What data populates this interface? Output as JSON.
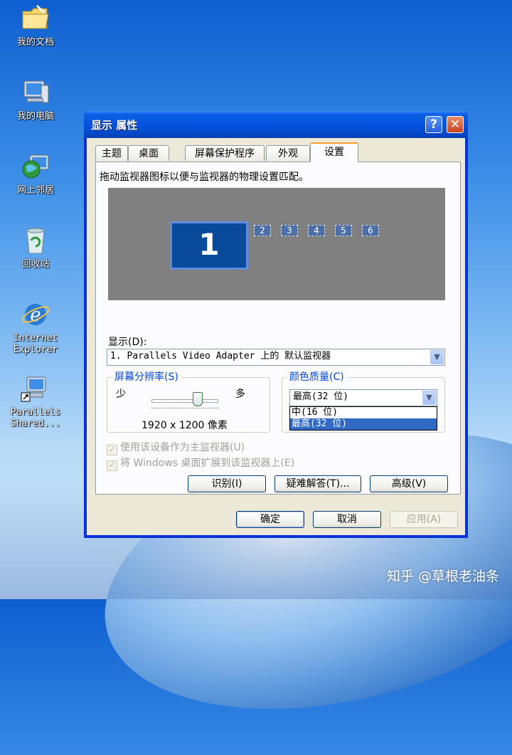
{
  "desktop": {
    "icons": [
      {
        "label": "我的文档",
        "icon": "folder-icon"
      },
      {
        "label": "我的电脑",
        "icon": "computer-icon"
      },
      {
        "label": "网上邻居",
        "icon": "network-icon"
      },
      {
        "label": "回收站",
        "icon": "recycle-bin-icon"
      },
      {
        "label1": "Internet",
        "label2": "Explorer",
        "icon": "ie-icon"
      },
      {
        "label1": "Parallels",
        "label2": "Shared...",
        "icon": "shortcut-icon"
      }
    ],
    "watermark": "知乎 @草根老油条"
  },
  "dialog": {
    "title": "显示 属性",
    "help": "?",
    "close": "✕",
    "tabs": [
      "主题",
      "桌面",
      "屏幕保护程序",
      "外观",
      "设置"
    ],
    "active_tab": "设置",
    "instruction": "拖动监视器图标以便与监视器的物理设置匹配。",
    "monitors": [
      "1",
      "2",
      "3",
      "4",
      "5",
      "6"
    ],
    "display_label": "显示(D):",
    "display_value": "1. Parallels Video Adapter 上的 默认监视器",
    "resolution": {
      "title": "屏幕分辨率(S)",
      "less": "少",
      "more": "多",
      "value": "1920 x 1200 像素",
      "slider_fraction": 0.7
    },
    "color": {
      "title": "颜色质量(C)",
      "value": "最高(32 位)",
      "options": [
        "中(16 位)",
        "最高(32 位)"
      ]
    },
    "checkboxes": [
      {
        "label": "使用该设备作为主监视器(U)",
        "checked": true
      },
      {
        "label": "将 Windows 桌面扩展到该监视器上(E)",
        "checked": true
      }
    ],
    "buttons": {
      "identify": "识别(I)",
      "troubleshoot": "疑难解答(T)...",
      "advanced": "高级(V)",
      "ok": "确定",
      "cancel": "取消",
      "apply": "应用(A)"
    }
  },
  "colors": {
    "titlebar": "#0553e0",
    "face": "#ece9d8",
    "selection": "#316ac5",
    "group_title": "#0046d5"
  }
}
